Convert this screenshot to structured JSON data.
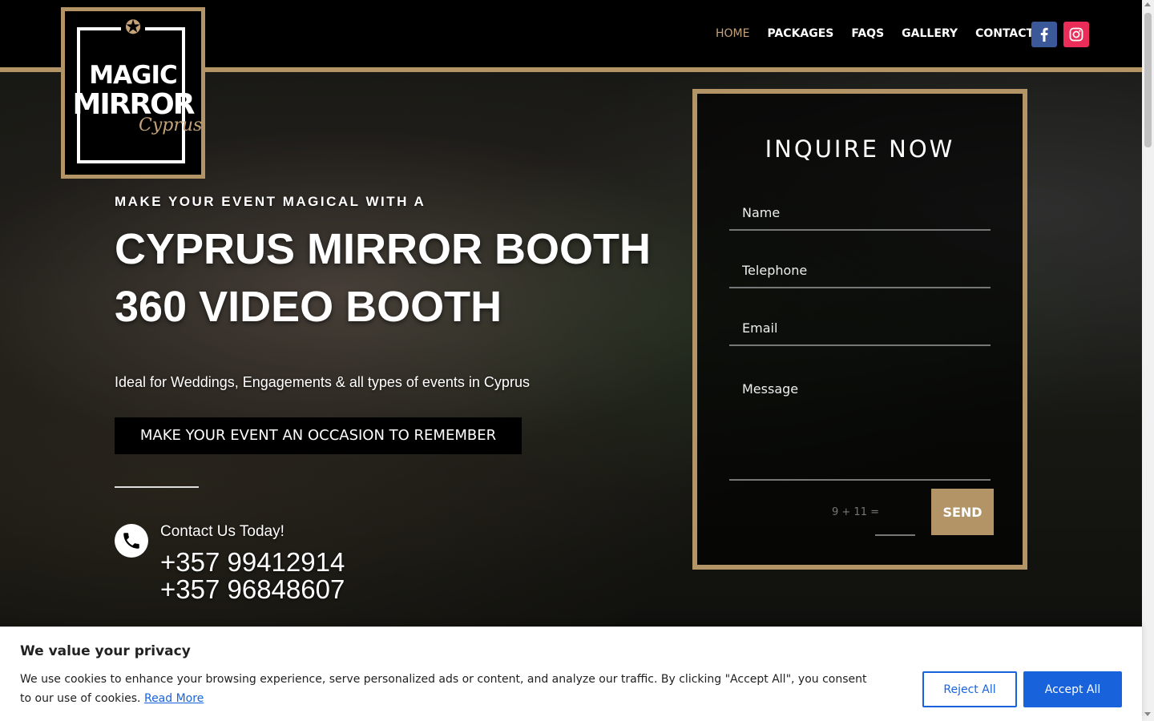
{
  "nav": {
    "items": [
      {
        "label": "HOME",
        "active": true
      },
      {
        "label": "PACKAGES",
        "active": false
      },
      {
        "label": "FAQS",
        "active": false
      },
      {
        "label": "GALLERY",
        "active": false
      },
      {
        "label": "CONTACT",
        "active": false
      }
    ]
  },
  "social": {
    "facebook_icon": "facebook-icon",
    "instagram_icon": "instagram-icon",
    "facebook_color": "#3b5998",
    "instagram_color": "#ea2c59"
  },
  "logo": {
    "line1": "MAGIC",
    "line2": "MIRROR",
    "script": "Cyprus"
  },
  "hero": {
    "kicker": "MAKE YOUR EVENT MAGICAL WITH A",
    "headline_line1": "CYPRUS MIRROR BOOTH",
    "headline_line2": "360 VIDEO BOOTH",
    "subtitle": "Ideal for Weddings, Engagements & all types of events in Cyprus",
    "cta_label": "MAKE YOUR EVENT AN OCCASION TO REMEMBER",
    "contact_label": "Contact Us Today!",
    "phone1": "+357 99412914",
    "phone2": "+357 96848607"
  },
  "form": {
    "title": "INQUIRE NOW",
    "name_placeholder": "Name",
    "telephone_placeholder": "Telephone",
    "email_placeholder": "Email",
    "message_placeholder": "Message",
    "captcha": "9 + 11 =",
    "send_label": "SEND"
  },
  "cookie": {
    "title": "We value your privacy",
    "text": "We use cookies to enhance your browsing experience, serve personalized ads or content, and analyze our traffic. By clicking \"Accept All\", you consent to our use of cookies.",
    "read_more": "Read More",
    "reject_label": "Reject All",
    "accept_label": "Accept All"
  },
  "colors": {
    "gold": "#b39466",
    "accent_blue": "#1863dc"
  }
}
